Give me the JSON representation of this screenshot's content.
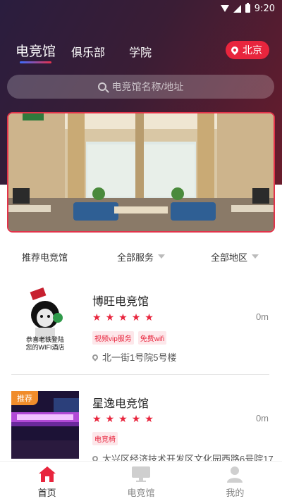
{
  "status_bar": {
    "time": "9:20"
  },
  "top_tabs": [
    {
      "label": "电竞馆",
      "active": true
    },
    {
      "label": "俱乐部",
      "active": false
    },
    {
      "label": "学院",
      "active": false
    }
  ],
  "city": {
    "label": "北京"
  },
  "search": {
    "placeholder": "电竞馆名称/地址"
  },
  "filters": {
    "recommend": "推荐电竞馆",
    "services": "全部服务",
    "regions": "全部地区"
  },
  "venues": [
    {
      "name": "博旺电竞馆",
      "rating": 5,
      "distance": "0m",
      "tags": [
        "视频vip服务",
        "免费wifi"
      ],
      "address": "北一街1号院5号楼",
      "thumb_caption_1": "恭喜老铁登陆",
      "thumb_caption_2": "您的WIFI酒店"
    },
    {
      "badge": "推荐",
      "name": "星逸电竞馆",
      "rating": 5,
      "distance": "0m",
      "tags": [
        "电竞椅"
      ],
      "address": "大兴区经济技术开发区文化园西路6号院17"
    }
  ],
  "bottom_nav": [
    {
      "label": "首页",
      "icon": "home-icon",
      "active": true
    },
    {
      "label": "电竞馆",
      "icon": "monitor-icon",
      "active": false
    },
    {
      "label": "我的",
      "icon": "user-icon",
      "active": false
    }
  ],
  "colors": {
    "accent": "#e8253d",
    "badge": "#f08c2b",
    "hero_start": "#2a1d3e",
    "hero_end": "#6a1c2c"
  }
}
